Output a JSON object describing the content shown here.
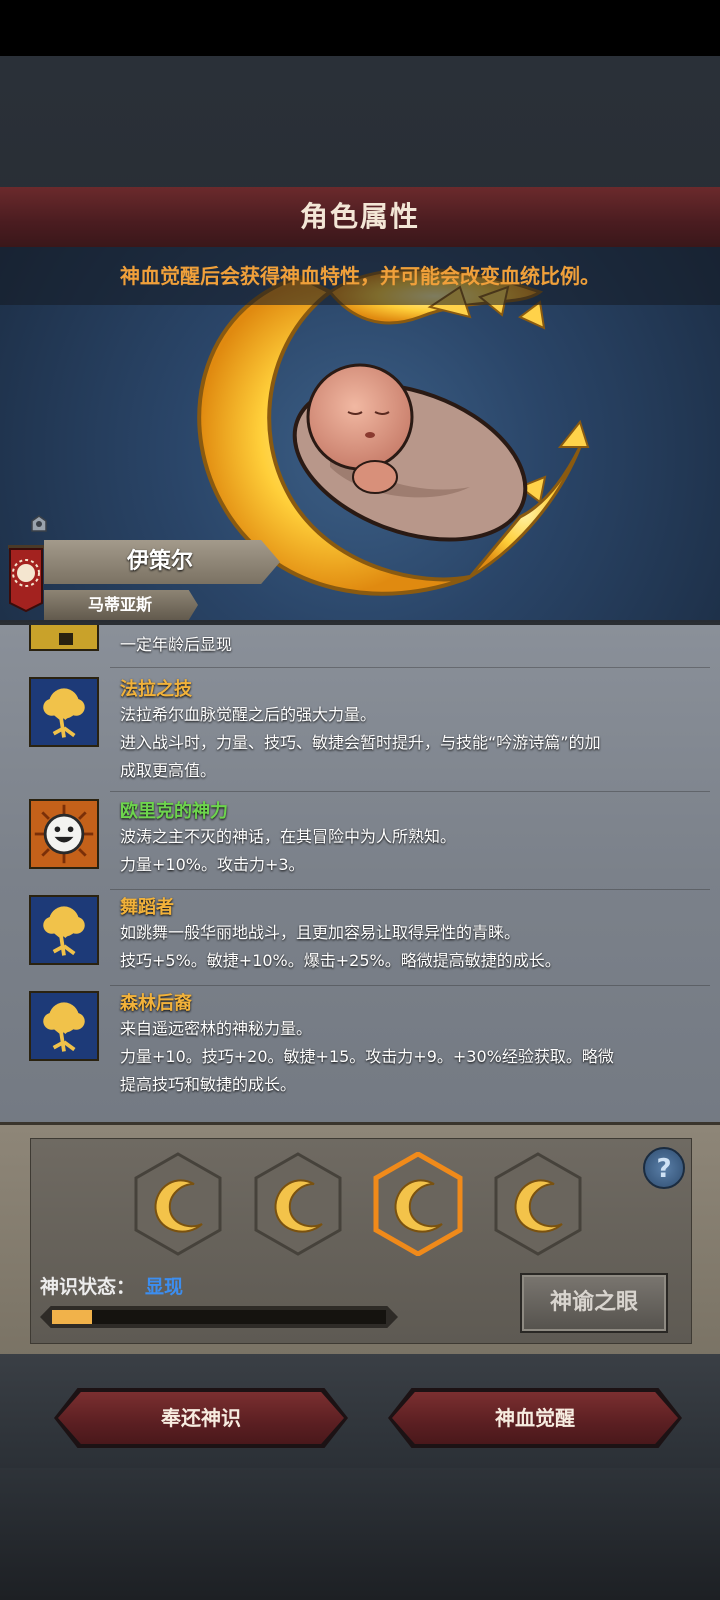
{
  "title": "角色属性",
  "notice": "神血觉醒后会获得神血特性，并可能会改变血统比例。",
  "character": {
    "name": "伊策尔",
    "house": "马蒂亚斯",
    "banner_color": "#a3221f"
  },
  "traits": [
    {
      "name": "",
      "desc": "一定年龄后显现",
      "icon": "partial-trait-icon"
    },
    {
      "name": "法拉之技",
      "desc_lines": [
        "法拉希尔血脉觉醒之后的强大力量。",
        "进入战斗时，力量、技巧、敏捷会暂时提升，与技能“吟游诗篇”的加",
        "成取更高值。"
      ],
      "icon": "golden-tree-icon",
      "name_color": "orange"
    },
    {
      "name": "欧里克的神力",
      "desc_lines": [
        "波涛之主不灭的神话，在其冒险中为人所熟知。",
        "力量+10%。攻击力+3。"
      ],
      "icon": "smiling-sun-icon",
      "name_color": "green"
    },
    {
      "name": "舞蹈者",
      "desc_lines": [
        "如跳舞一般华丽地战斗，且更加容易让取得异性的青睐。",
        "技巧+5%。敏捷+10%。爆击+25%。略微提高敏捷的成长。"
      ],
      "icon": "golden-tree-icon",
      "name_color": "orange"
    },
    {
      "name": "森林后裔",
      "desc_lines": [
        "来自遥远密林的神秘力量。",
        "力量+10。技巧+20。敏捷+15。攻击力+9。+30%经验获取。略微",
        "提高技巧和敏捷的成长。"
      ],
      "icon": "golden-tree-icon",
      "name_color": "orange"
    }
  ],
  "divine_slots": [
    {
      "icon": "divine-moon-tree-icon",
      "selected": false
    },
    {
      "icon": "divine-moon-tree-icon",
      "selected": false
    },
    {
      "icon": "divine-moon-tree-icon",
      "selected": true
    },
    {
      "icon": "divine-moon-tree-icon",
      "selected": false
    }
  ],
  "status": {
    "label": "神识状态：",
    "value": "显现",
    "progress": 0.12
  },
  "buttons": {
    "oracle": "神谕之眼",
    "return": "奉还神识",
    "awaken": "神血觉醒",
    "help": "?"
  },
  "colors": {
    "accent_gold": "#f2b23a",
    "notice_orange": "#f0a03a",
    "trait_green": "#6dd44d",
    "state_blue": "#3c8ef0"
  }
}
